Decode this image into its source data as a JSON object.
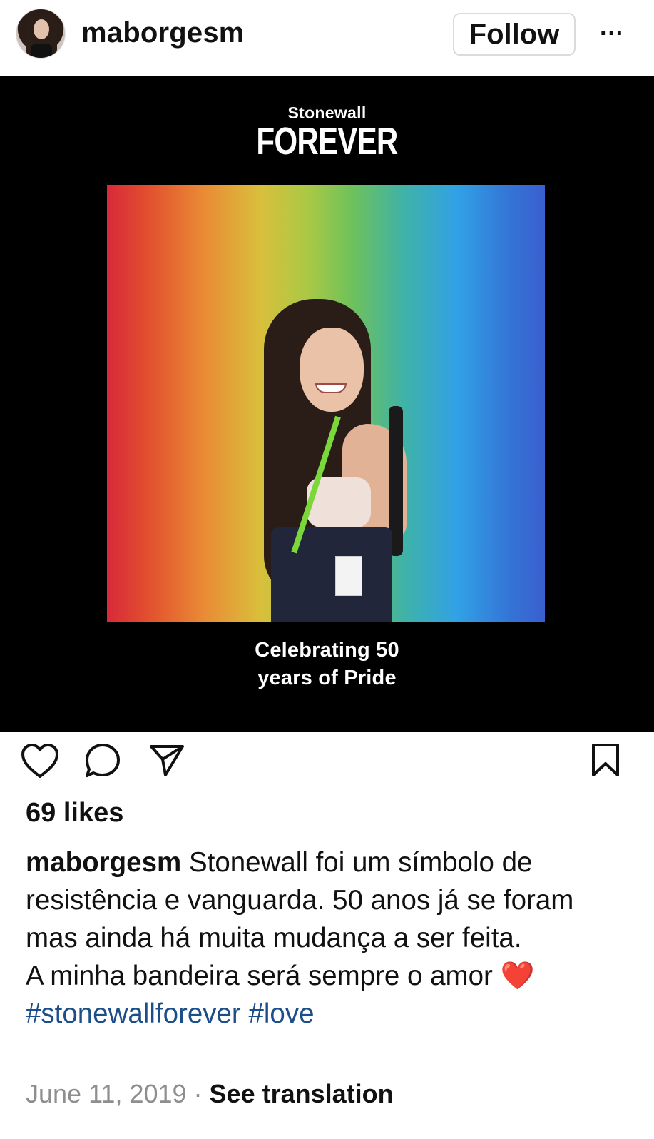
{
  "header": {
    "username": "maborgesm",
    "follow_label": "Follow",
    "more_label": "···"
  },
  "post_image": {
    "brand_line1": "Stonewall",
    "brand_line2": "FOREVER",
    "caption_line1": "Celebrating 50",
    "caption_line2": "years of Pride"
  },
  "engagement": {
    "likes": "69 likes"
  },
  "caption": {
    "username": "maborgesm",
    "text1": "Stonewall foi um símbolo de resistência e vanguarda. 50 anos já se foram mas ainda há muita mudança a ser feita.",
    "text2": "A minha bandeira será sempre o amor",
    "heart": "❤️",
    "hashtags": [
      "#stonewallforever",
      "#love"
    ]
  },
  "meta": {
    "date": "June 11, 2019",
    "separator": "·",
    "see_translation": "See translation"
  },
  "colors": {
    "hashtag": "#1c4f8a",
    "muted": "#8e8e8e",
    "text": "#111111"
  }
}
